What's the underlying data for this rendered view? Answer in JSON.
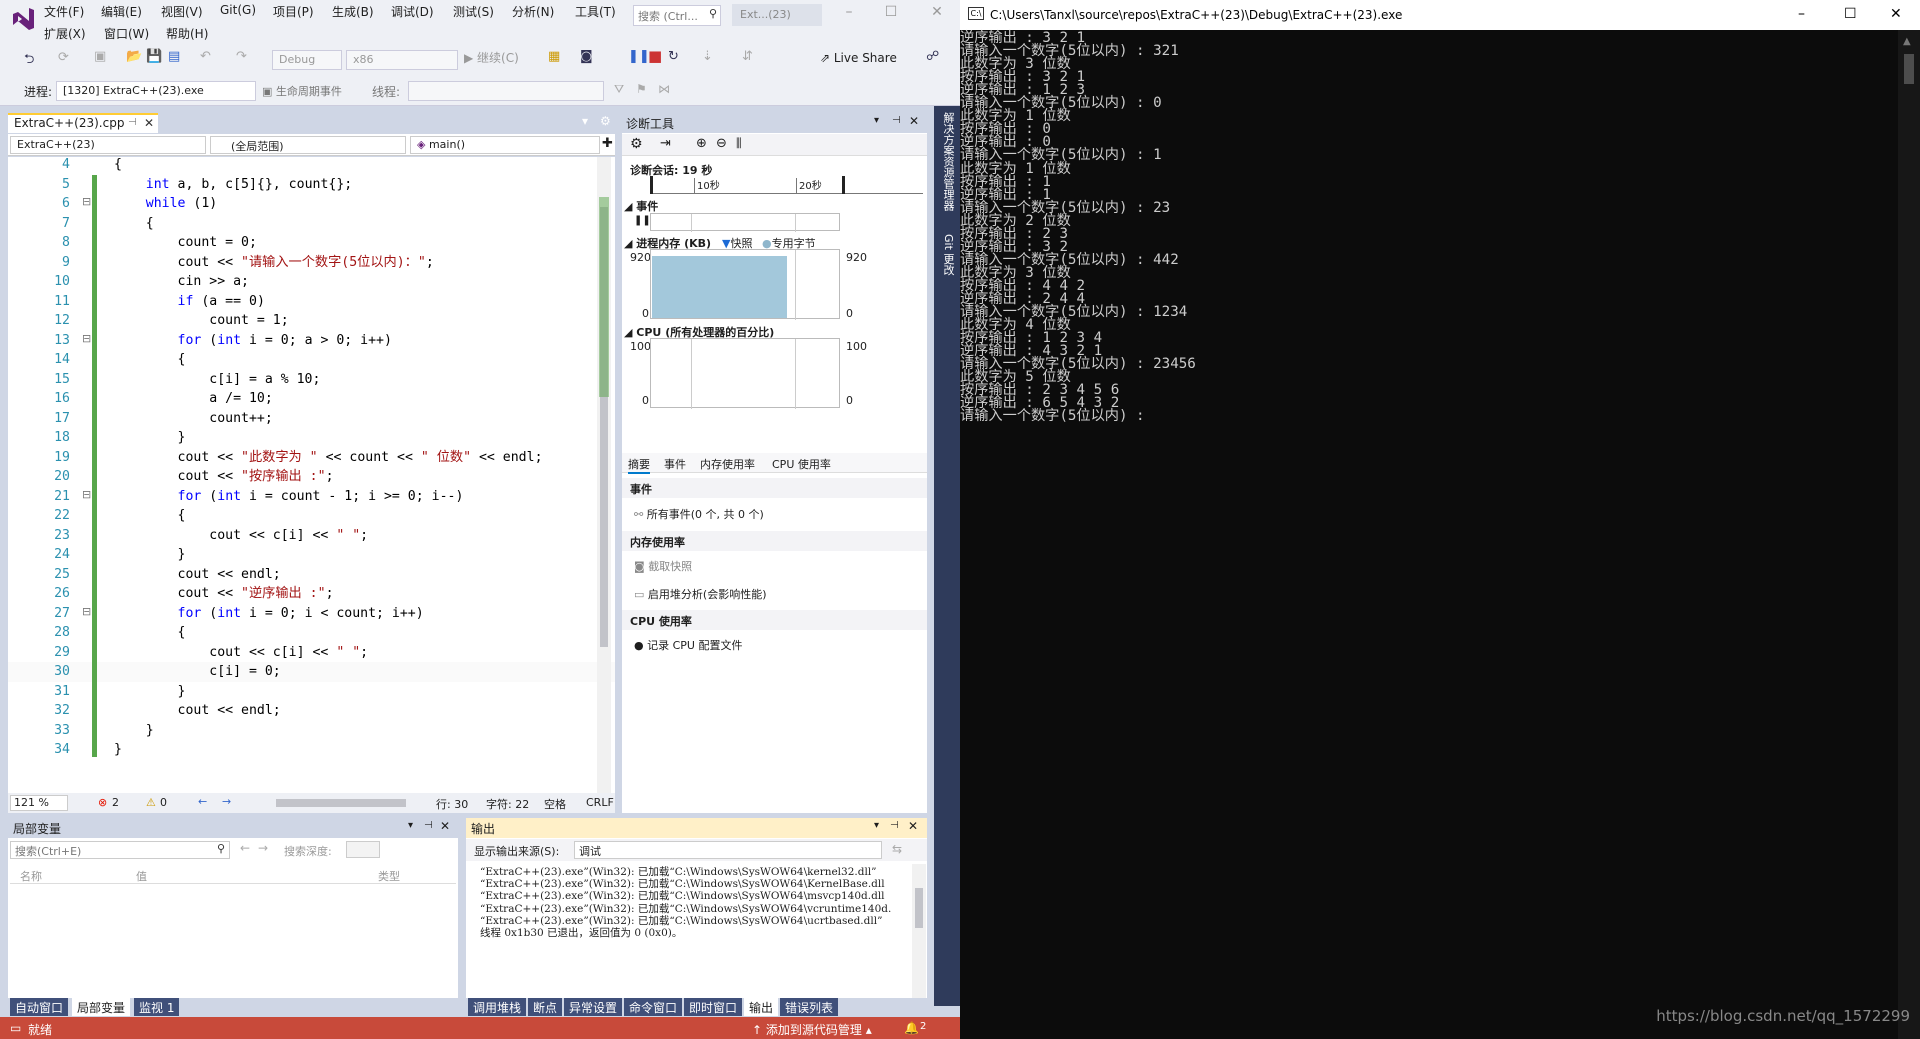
{
  "vs": {
    "menu_row1": [
      "文件(F)",
      "编辑(E)",
      "视图(V)",
      "Git(G)",
      "项目(P)",
      "生成(B)",
      "调试(D)",
      "测试(S)",
      "分析(N)",
      "工具(T)"
    ],
    "menu_row2": [
      "扩展(X)",
      "窗口(W)",
      "帮助(H)"
    ],
    "search_placeholder": "搜索 (Ctrl...",
    "title": "Ext...(23)",
    "toolbar": {
      "config": "Debug",
      "platform": "x86",
      "continue": "继续(C)",
      "live_share": "Live Share"
    },
    "toolbar2": {
      "process_label": "进程:",
      "process_value": "[1320] ExtraC++(23).exe",
      "lifecycle": "生命周期事件",
      "thread_label": "线程:"
    },
    "editor": {
      "tab": "ExtraC++(23).cpp",
      "nav_project": "ExtraC++(23)",
      "nav_scope": "(全局范围)",
      "nav_func": "main()",
      "status": {
        "zoom": "121 %",
        "errors": "2",
        "warnings": "0",
        "line": "行: 30",
        "char": "字符: 22",
        "space": "空格",
        "eol": "CRLF"
      }
    },
    "diagnostics": {
      "title": "诊断工具",
      "session": "诊断会话: 19 秒",
      "tick1": "10秒",
      "tick2": "20秒",
      "events_label": "事件",
      "memory_label": "进程内存 (KB)",
      "legend_snapshot": "快照",
      "legend_private": "专用字节",
      "mem_max": "920",
      "mem_min": "0",
      "cpu_label": "CPU (所有处理器的百分比)",
      "cpu_max": "100",
      "cpu_min": "0",
      "tabs": [
        "摘要",
        "事件",
        "内存使用率",
        "CPU 使用率"
      ],
      "events_header": "事件",
      "all_events": "所有事件(0 个, 共 0 个)",
      "memory_header": "内存使用率",
      "take_snapshot": "截取快照",
      "heap_profiling": "启用堆分析(会影响性能)",
      "cpu_header": "CPU 使用率",
      "record_cpu": "记录 CPU 配置文件"
    },
    "side_strip": [
      "解决方案资源管理器",
      "Git 更改"
    ],
    "locals": {
      "title": "局部变量",
      "search": "搜索(Ctrl+E)",
      "depth": "搜索深度:",
      "col_name": "名称",
      "col_value": "值",
      "col_type": "类型",
      "tabs": [
        "自动窗口",
        "局部变量",
        "监视 1"
      ]
    },
    "output": {
      "title": "输出",
      "source_label": "显示输出来源(S):",
      "source_value": "调试",
      "lines": [
        "“ExtraC++(23).exe”(Win32): 已加载“C:\\Windows\\SysWOW64\\kernel32.dll”",
        "“ExtraC++(23).exe”(Win32): 已加载“C:\\Windows\\SysWOW64\\KernelBase.dll",
        "“ExtraC++(23).exe”(Win32): 已加载“C:\\Windows\\SysWOW64\\msvcp140d.dll",
        "“ExtraC++(23).exe”(Win32): 已加载“C:\\Windows\\SysWOW64\\vcruntime140d.",
        "“ExtraC++(23).exe”(Win32): 已加载“C:\\Windows\\SysWOW64\\ucrtbased.dll”",
        "线程 0x1b30 已退出，返回值为 0 (0x0)。"
      ],
      "tabs": [
        "调用堆栈",
        "断点",
        "异常设置",
        "命令窗口",
        "即时窗口",
        "输出",
        "错误列表"
      ]
    },
    "statusbar": {
      "ready": "就绪",
      "source_control": "添加到源代码管理",
      "notifications": "2"
    }
  },
  "code": [
    {
      "n": "4",
      "html": "{"
    },
    {
      "n": "5",
      "html": "    <span class='kw'>int</span> a, b, c[5]{}, count{};"
    },
    {
      "n": "6",
      "html": "    <span class='kw'>while</span> (1)"
    },
    {
      "n": "7",
      "html": "    {"
    },
    {
      "n": "8",
      "html": "        count = 0;"
    },
    {
      "n": "9",
      "html": "        cout &lt;&lt; <span class='str'>\"请输入一个数字(5位以内)：\"</span>;"
    },
    {
      "n": "10",
      "html": "        cin &gt;&gt; a;"
    },
    {
      "n": "11",
      "html": "        <span class='kw'>if</span> (a == 0)"
    },
    {
      "n": "12",
      "html": "            count = 1;"
    },
    {
      "n": "13",
      "html": "        <span class='kw'>for</span> (<span class='kw'>int</span> i = 0; a &gt; 0; i++)"
    },
    {
      "n": "14",
      "html": "        {"
    },
    {
      "n": "15",
      "html": "            c[i] = a % 10;"
    },
    {
      "n": "16",
      "html": "            a /= 10;"
    },
    {
      "n": "17",
      "html": "            count++;"
    },
    {
      "n": "18",
      "html": "        }"
    },
    {
      "n": "19",
      "html": "        cout &lt;&lt; <span class='str'>\"此数字为 \"</span> &lt;&lt; count &lt;&lt; <span class='str'>\" 位数\"</span> &lt;&lt; endl;"
    },
    {
      "n": "20",
      "html": "        cout &lt;&lt; <span class='str'>\"按序输出 :\"</span>;"
    },
    {
      "n": "21",
      "html": "        <span class='kw'>for</span> (<span class='kw'>int</span> i = count - 1; i &gt;= 0; i--)"
    },
    {
      "n": "22",
      "html": "        {"
    },
    {
      "n": "23",
      "html": "            cout &lt;&lt; c[i] &lt;&lt; <span class='str'>\" \"</span>;"
    },
    {
      "n": "24",
      "html": "        }"
    },
    {
      "n": "25",
      "html": "        cout &lt;&lt; endl;"
    },
    {
      "n": "26",
      "html": "        cout &lt;&lt; <span class='str'>\"逆序输出 :\"</span>;"
    },
    {
      "n": "27",
      "html": "        <span class='kw'>for</span> (<span class='kw'>int</span> i = 0; i &lt; count; i++)"
    },
    {
      "n": "28",
      "html": "        {"
    },
    {
      "n": "29",
      "html": "            cout &lt;&lt; c[i] &lt;&lt; <span class='str'>\" \"</span>;"
    },
    {
      "n": "30",
      "html": "            c[i] = 0;"
    },
    {
      "n": "31",
      "html": "        }"
    },
    {
      "n": "32",
      "html": "        cout &lt;&lt; endl;"
    },
    {
      "n": "33",
      "html": "    }"
    },
    {
      "n": "34",
      "html": "}"
    }
  ],
  "console": {
    "title": "C:\\Users\\Tanxl\\source\\repos\\ExtraC++(23)\\Debug\\ExtraC++(23).exe",
    "lines": [
      "逆序输出 : 3 2 1",
      "请输入一个数字(5位以内) : 321",
      "此数字为 3 位数",
      "按序输出 : 3 2 1",
      "逆序输出 : 1 2 3",
      "请输入一个数字(5位以内) : 0",
      "此数字为 1 位数",
      "按序输出 : 0",
      "逆序输出 : 0",
      "请输入一个数字(5位以内) : 1",
      "此数字为 1 位数",
      "按序输出 : 1",
      "逆序输出 : 1",
      "请输入一个数字(5位以内) : 23",
      "此数字为 2 位数",
      "按序输出 : 2 3",
      "逆序输出 : 3 2",
      "请输入一个数字(5位以内) : 442",
      "此数字为 3 位数",
      "按序输出 : 4 4 2",
      "逆序输出 : 2 4 4",
      "请输入一个数字(5位以内) : 1234",
      "此数字为 4 位数",
      "按序输出 : 1 2 3 4",
      "逆序输出 : 4 3 2 1",
      "请输入一个数字(5位以内) : 23456",
      "此数字为 5 位数",
      "按序输出 : 2 3 4 5 6",
      "逆序输出 : 6 5 4 3 2",
      "请输入一个数字(5位以内) :"
    ],
    "watermark": "https://blog.csdn.net/qq_1572299"
  }
}
